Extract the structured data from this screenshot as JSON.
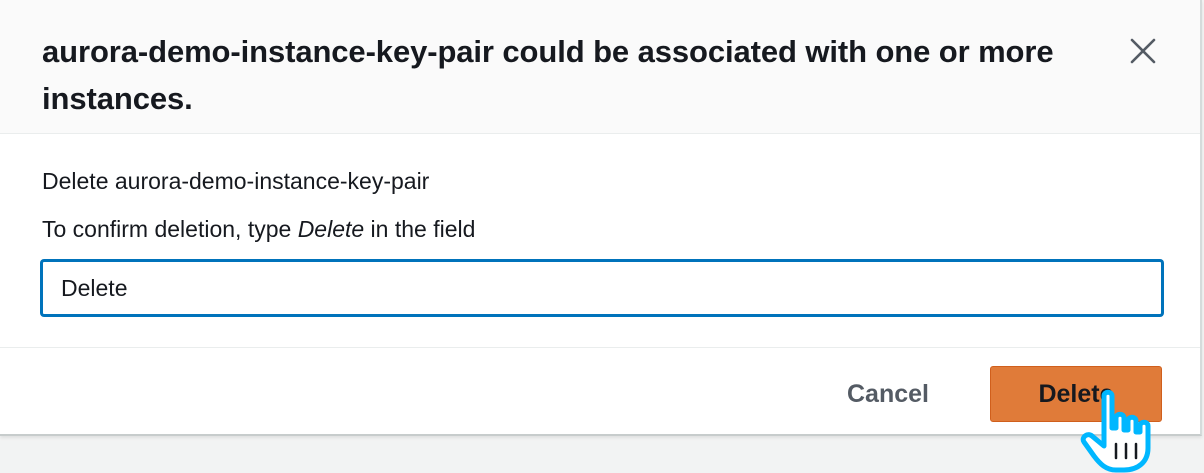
{
  "dialog": {
    "title": "aurora-demo-instance-key-pair could be associated with one or more instances.",
    "close_icon": "close-icon",
    "body": {
      "delete_line": "Delete aurora-demo-instance-key-pair",
      "confirm_prefix": "To confirm deletion, type ",
      "confirm_keyword": "Delete",
      "confirm_suffix": " in the field",
      "input_value": "Delete"
    },
    "footer": {
      "cancel_label": "Cancel",
      "delete_label": "Delete"
    }
  },
  "colors": {
    "primary_button": "#e07b39",
    "input_focus_border": "#0073bb",
    "cursor_highlight": "#00b7ff"
  },
  "pointer": {
    "icon": "hand-pointer-icon"
  }
}
